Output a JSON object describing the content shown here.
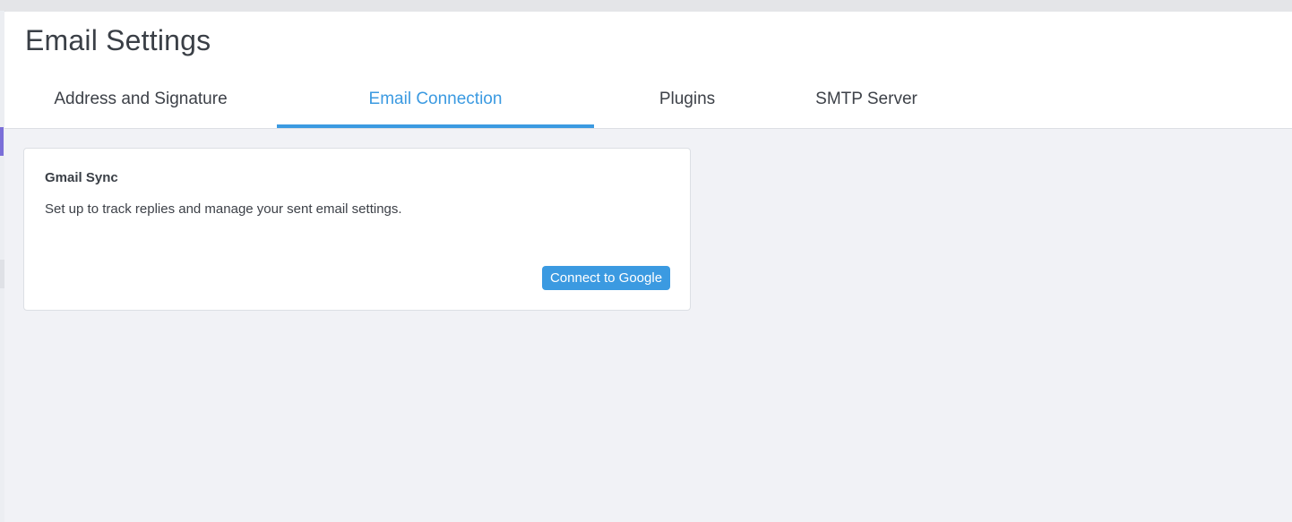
{
  "page": {
    "title": "Email Settings"
  },
  "tabs": [
    {
      "label": "Address and Signature",
      "active": false
    },
    {
      "label": "Email Connection",
      "active": true
    },
    {
      "label": "Plugins",
      "active": false
    },
    {
      "label": "SMTP Server",
      "active": false
    }
  ],
  "gmail_card": {
    "title": "Gmail Sync",
    "description": "Set up to track replies and manage your sent email settings.",
    "connect_label": "Connect to Google"
  },
  "colors": {
    "accent": "#3b9ae1",
    "nav_indicator": "#7b6fd8",
    "page_background": "#f1f2f6",
    "text": "#3a3f46"
  }
}
